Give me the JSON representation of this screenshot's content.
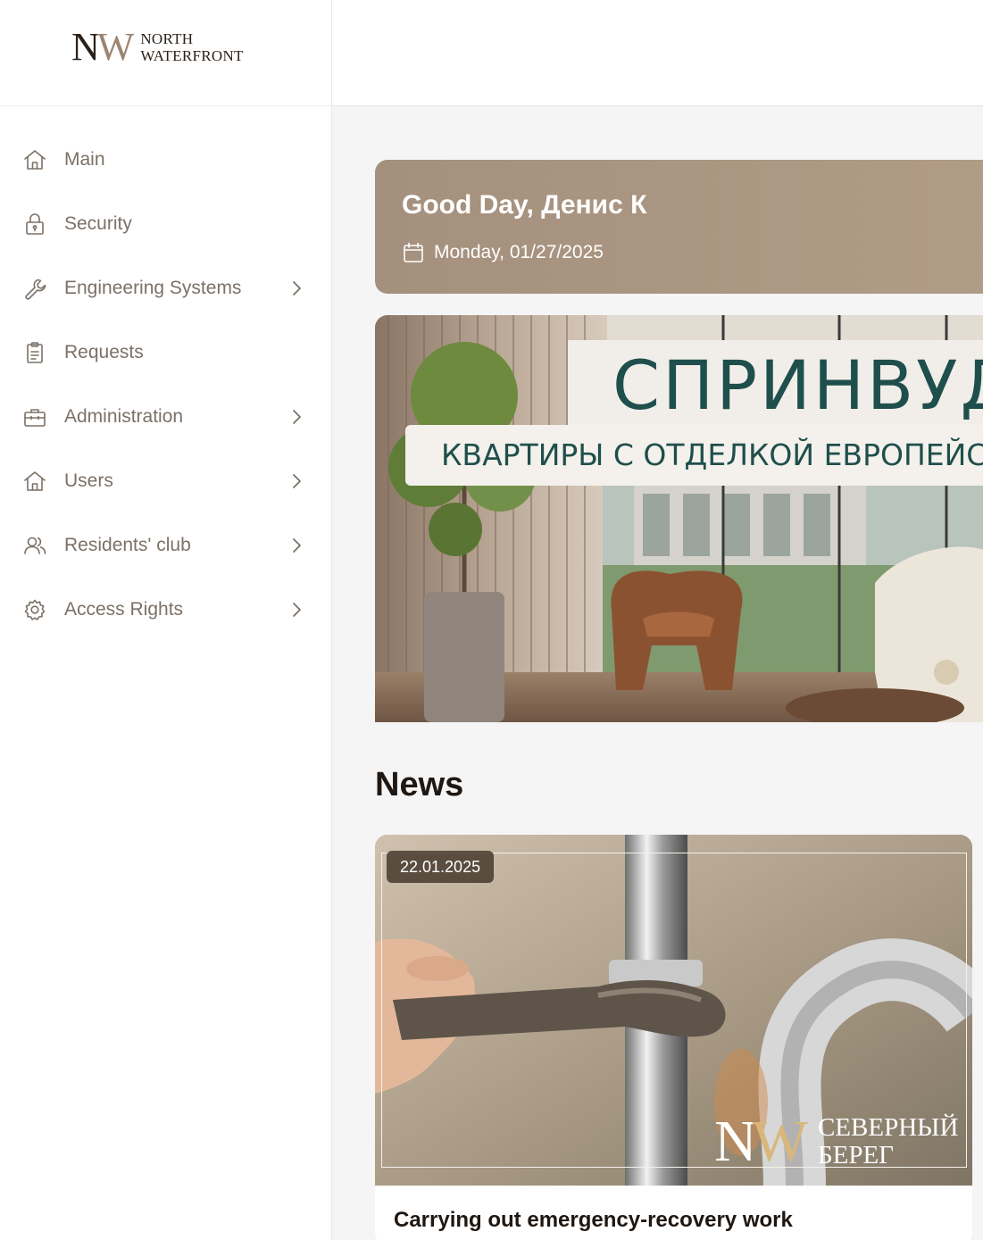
{
  "brand": {
    "mark": "NW",
    "name_line1": "NORTH",
    "name_line2": "WATERFRONT"
  },
  "sidebar": {
    "items": [
      {
        "label": "Main",
        "icon": "home-icon",
        "has_submenu": false
      },
      {
        "label": "Security",
        "icon": "lock-icon",
        "has_submenu": false
      },
      {
        "label": "Engineering Systems",
        "icon": "wrench-icon",
        "has_submenu": true
      },
      {
        "label": "Requests",
        "icon": "clipboard-icon",
        "has_submenu": false
      },
      {
        "label": "Administration",
        "icon": "briefcase-icon",
        "has_submenu": true
      },
      {
        "label": "Users",
        "icon": "home-icon",
        "has_submenu": true
      },
      {
        "label": "Residents' club",
        "icon": "users-icon",
        "has_submenu": true
      },
      {
        "label": "Access Rights",
        "icon": "gear-icon",
        "has_submenu": true
      }
    ]
  },
  "greeting": {
    "title": "Good Day, Денис К",
    "date": "Monday, 01/27/2025",
    "color": "#a4907d"
  },
  "banner": {
    "title": "СПРИНВУД",
    "subtitle": "КВАРТИРЫ С ОТДЕЛКОЙ ЕВРОПЕЙСКОГО",
    "text_color": "#1f4f4c"
  },
  "news": {
    "section_title": "News",
    "items": [
      {
        "date": "22.01.2025",
        "logo_mark": "NW",
        "logo_line1": "СЕВЕРНЫЙ",
        "logo_line2": "БЕРЕГ",
        "headline": "Carrying out emergency-recovery work"
      }
    ]
  }
}
